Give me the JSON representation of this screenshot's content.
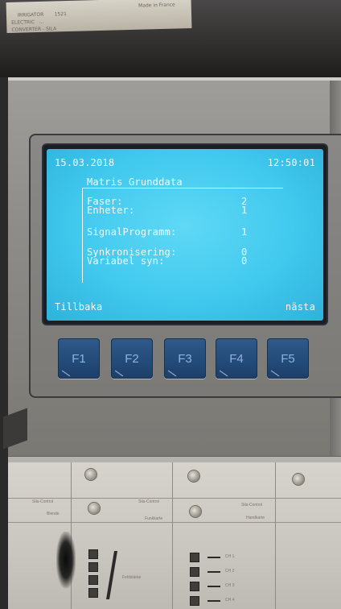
{
  "sticker": {
    "lines": "IRRIGATOR       1521\nELECTRIC   ...\nCONVERTER - SILA",
    "made_in": "Made in France"
  },
  "lcd": {
    "date": "15.03.2018",
    "time": "12:50:01",
    "heading": "Matris Grunddata",
    "rows": [
      {
        "label": "Faser:",
        "value": "2"
      },
      {
        "label": "Enheter:",
        "value": "1"
      },
      {
        "label": "SignalProgramm:",
        "value": "1"
      },
      {
        "label": "Synkronisering:",
        "value": "0"
      },
      {
        "label": "Variabel syn:",
        "value": "0"
      }
    ],
    "softkey_left": "Tillbaka",
    "softkey_right": "nästa"
  },
  "function_keys": [
    "F1",
    "F2",
    "F3",
    "F4",
    "F5"
  ],
  "rack": {
    "module1": {
      "brand": "Sila-Control",
      "name": "Blende"
    },
    "module2": {
      "brand": "Sila-Control",
      "name": "Funkkarte",
      "meter_label": "Feldstärke"
    },
    "module3": {
      "brand": "Sila-Control",
      "name": "Handkarte",
      "channels": [
        "CH 1",
        "CH 2",
        "CH 3",
        "CH 4"
      ]
    }
  },
  "colors": {
    "lcd_background": "#45ccef",
    "lcd_text": "#f2fbff",
    "function_key": "#234a78"
  }
}
